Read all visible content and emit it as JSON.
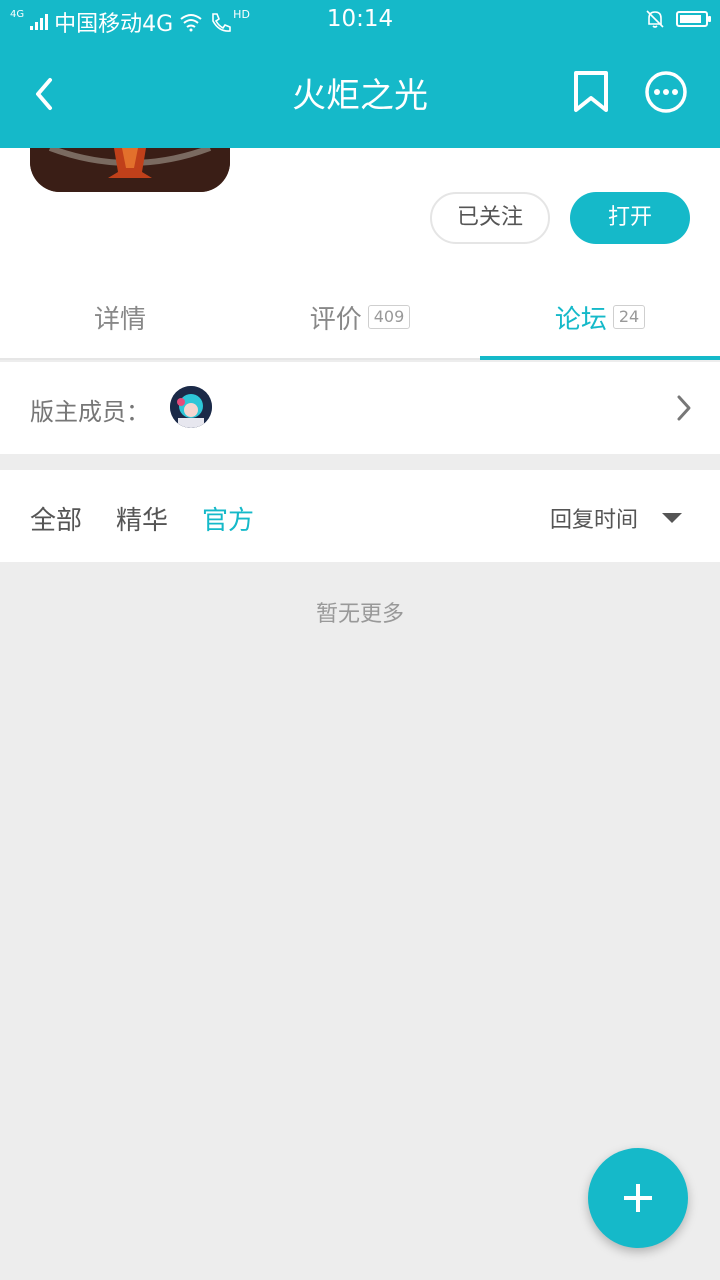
{
  "status_bar": {
    "network_tag": "4G",
    "carrier": "中国移动4G",
    "hd_label": "HD",
    "time": "10:14"
  },
  "app_bar": {
    "title": "火炬之光"
  },
  "actions": {
    "follow_label": "已关注",
    "open_label": "打开"
  },
  "tabs": [
    {
      "label": "详情"
    },
    {
      "label": "评价",
      "count": "409"
    },
    {
      "label": "论坛",
      "count": "24"
    }
  ],
  "moderators": {
    "label": "版主成员："
  },
  "filters": {
    "items": [
      {
        "label": "全部"
      },
      {
        "label": "精华"
      },
      {
        "label": "官方"
      }
    ],
    "sort_label": "回复时间"
  },
  "empty_text": "暂无更多",
  "colors": {
    "accent": "#15b9c9",
    "page_background": "#ededed"
  }
}
